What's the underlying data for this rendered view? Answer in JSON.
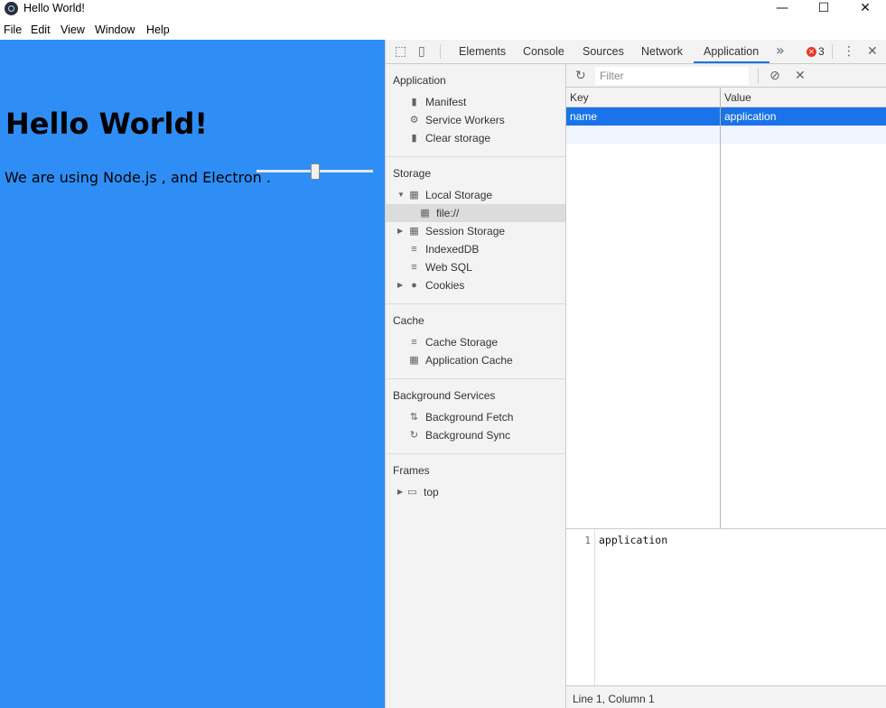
{
  "window": {
    "title": "Hello World!",
    "minimize_glyph": "—",
    "maximize_glyph": "☐",
    "close_glyph": "✕"
  },
  "menu": {
    "items": [
      "File",
      "Edit",
      "View",
      "Window",
      "Help"
    ]
  },
  "app": {
    "heading": "Hello World!",
    "paragraph": "We are using Node.js , and Electron .",
    "background_color": "#2e8ef6",
    "slider_value_percent": 50
  },
  "devtools": {
    "tabs": [
      "Elements",
      "Console",
      "Sources",
      "Network",
      "Application"
    ],
    "active_tab": "Application",
    "more_tabs_glyph": "»",
    "error_count": "3",
    "error_glyph": "✕",
    "menu_glyph": "⋮",
    "close_glyph": "✕",
    "inspect_glyph": "⬚",
    "device_glyph": "▯",
    "accent_color": "#1a73e8",
    "sidebar": {
      "application_title": "Application",
      "application_items": [
        "Manifest",
        "Service Workers",
        "Clear storage"
      ],
      "storage_title": "Storage",
      "storage_items": [
        "Local Storage",
        "file://",
        "Session Storage",
        "IndexedDB",
        "Web SQL",
        "Cookies"
      ],
      "cache_title": "Cache",
      "cache_items": [
        "Cache Storage",
        "Application Cache"
      ],
      "background_title": "Background Services",
      "background_items": [
        "Background Fetch",
        "Background Sync"
      ],
      "frames_title": "Frames",
      "frames_items": [
        "top"
      ]
    },
    "main": {
      "refresh_glyph": "↻",
      "filter_placeholder": "Filter",
      "block_glyph": "⊘",
      "clear_glyph": "✕",
      "columns": [
        "Key",
        "Value"
      ],
      "rows": [
        {
          "key": "name",
          "value": "application"
        }
      ],
      "preview_line_number": "1",
      "preview_text": "application",
      "status": "Line 1, Column 1"
    }
  }
}
